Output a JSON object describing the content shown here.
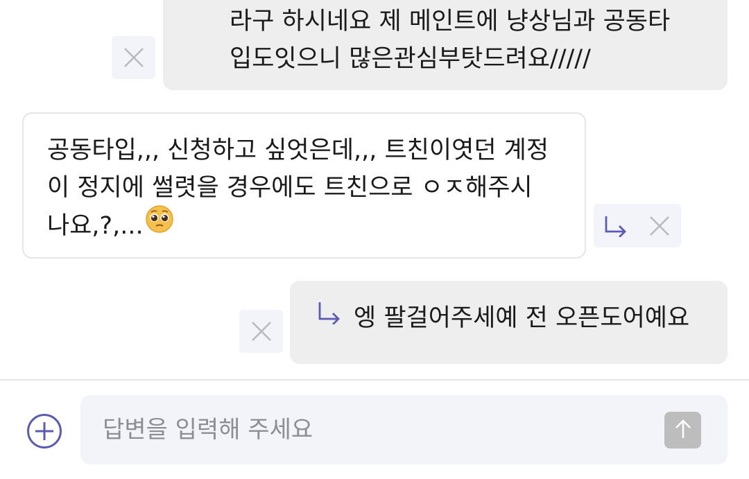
{
  "colors": {
    "accent": "#5b5bb5",
    "outgoing_bubble": "#eeeeef",
    "incoming_bubble_border": "#e6e6e8",
    "action_bg": "#f3f3fa",
    "icon_gray": "#b9b9be",
    "send_button": "#bdbdbd"
  },
  "messages": [
    {
      "direction": "outgoing",
      "lines": [
        "라구 하시네요 제 메인트에 냥상님과 공동타",
        "입도잇으니 많은관심부탓드려요/////"
      ],
      "actions": [
        "close-icon"
      ]
    },
    {
      "direction": "incoming",
      "lines": [
        "공동타입,,, 신청하고 싶엇은데,,, 트친이엿던 계정",
        "이 정지에 썰렷을 경우에도 트친으로 ㅇㅈ해주시",
        "나요,?,..."
      ],
      "emoji": "🥹",
      "actions": [
        "reply-arrow-icon",
        "close-icon"
      ]
    },
    {
      "direction": "outgoing",
      "is_reply": true,
      "lines": [
        "엥 팔걸어주세예 전 오픈도어예요"
      ],
      "actions": [
        "close-icon"
      ]
    }
  ],
  "composer": {
    "placeholder": "답변을 입력해 주세요",
    "value": "",
    "add_icon": "plus-circle-icon",
    "send_icon": "arrow-up-icon"
  }
}
